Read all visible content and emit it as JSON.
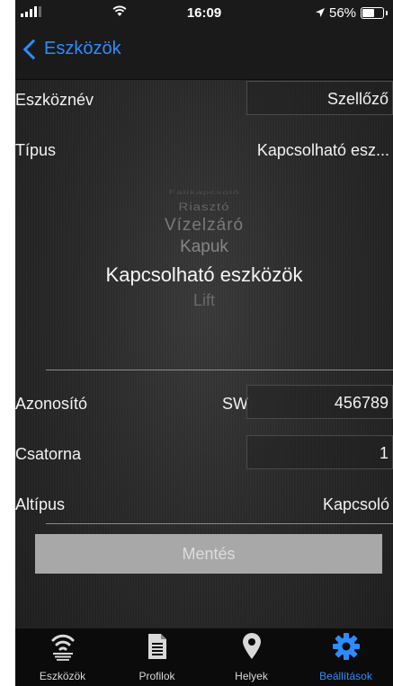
{
  "status_bar": {
    "time": "16:09",
    "battery": "56%",
    "battery_level": 0.56
  },
  "nav": {
    "back_label": "Eszközök"
  },
  "form": {
    "device_name": {
      "label": "Eszköznév",
      "value": "Szellőző"
    },
    "type": {
      "label": "Típus",
      "value": "Kapcsolható esz..."
    },
    "picker_options": [
      "Falikapcsoló",
      "Riasztó",
      "Vízelzáró",
      "Kapuk",
      "Kapcsolható eszközök",
      "Lift"
    ],
    "picker_selected": "Kapcsolható eszközök",
    "identifier": {
      "label": "Azonosító",
      "prefix": "SW",
      "value": "456789"
    },
    "channel": {
      "label": "Csatorna",
      "value": "1"
    },
    "subtype": {
      "label": "Altípus",
      "value": "Kapcsoló"
    }
  },
  "save_button": {
    "label": "Mentés"
  },
  "tabs": [
    {
      "label": "Eszközök",
      "icon": "wifi-devices-icon",
      "active": false
    },
    {
      "label": "Profilok",
      "icon": "document-icon",
      "active": false
    },
    {
      "label": "Helyek",
      "icon": "location-pin-icon",
      "active": false
    },
    {
      "label": "Beállítások",
      "icon": "gear-icon",
      "active": true
    }
  ],
  "colors": {
    "accent": "#2d8cff",
    "background": "#2a2a2a",
    "button": "#a8a8a8"
  }
}
